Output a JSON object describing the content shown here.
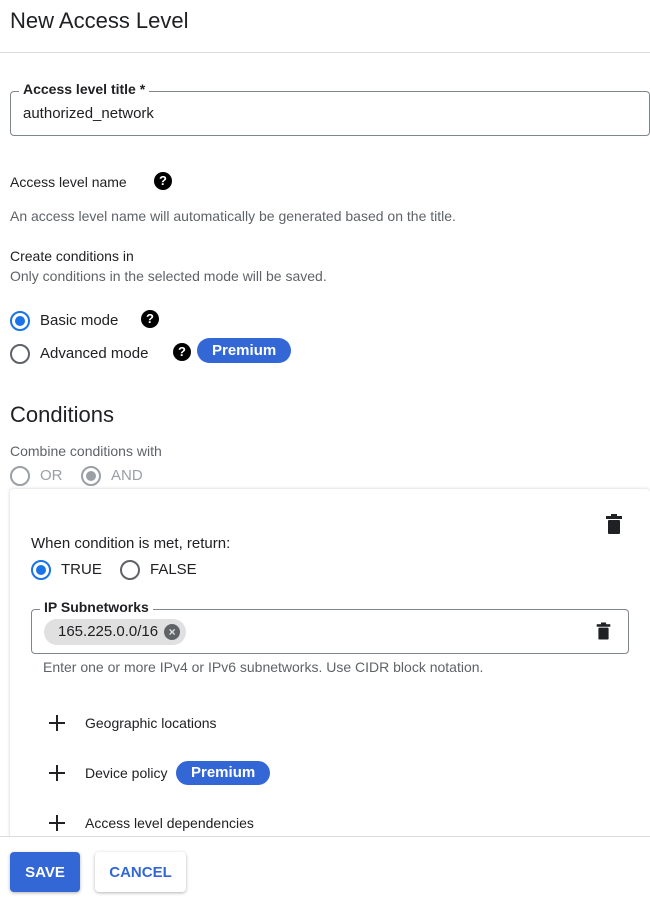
{
  "header": {
    "title": "New Access Level"
  },
  "access_title_field": {
    "label": "Access level title *",
    "value": "authorized_network"
  },
  "access_name": {
    "label": "Access level name",
    "help_icon": "help-icon",
    "description": "An access level name will automatically be generated based on the title."
  },
  "create_conditions": {
    "label": "Create conditions in",
    "hint": "Only conditions in the selected mode will be saved."
  },
  "mode": {
    "selected": "basic",
    "options": [
      {
        "id": "basic",
        "label": "Basic mode",
        "premium": false
      },
      {
        "id": "advanced",
        "label": "Advanced mode",
        "premium": true,
        "badge": "Premium"
      }
    ]
  },
  "conditions": {
    "heading": "Conditions",
    "combine_label": "Combine conditions with",
    "combine_options": [
      "OR",
      "AND"
    ],
    "combine_selected": "AND",
    "combine_disabled": true
  },
  "condition_card": {
    "return_label": "When condition is met, return:",
    "return_options": [
      "TRUE",
      "FALSE"
    ],
    "return_selected": "TRUE",
    "ip_field": {
      "label": "IP Subnetworks",
      "chips": [
        "165.225.0.0/16"
      ],
      "helper": "Enter one or more IPv4 or IPv6 subnetworks. Use CIDR block notation."
    },
    "add_items": [
      {
        "label": "Geographic locations",
        "badge": ""
      },
      {
        "label": "Device policy",
        "badge": "Premium"
      },
      {
        "label": "Access level dependencies",
        "badge": ""
      }
    ]
  },
  "footer": {
    "save_label": "SAVE",
    "cancel_label": "CANCEL"
  },
  "colors": {
    "accent": "#1a73e8",
    "premium_badge": "#3367d6",
    "button_primary": "#3367d6"
  }
}
